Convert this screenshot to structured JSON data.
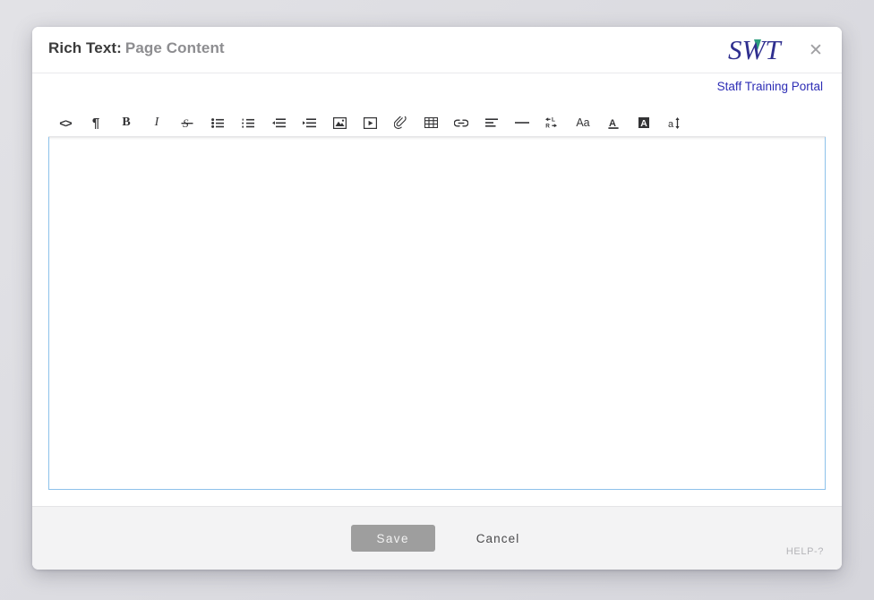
{
  "dialog": {
    "title_prefix": "Rich Text:",
    "title_field": "Page Content",
    "close_label": "✕",
    "brand": {
      "logo_text": "SWT",
      "logo_color": "#2f2f8f",
      "logo_accent_color": "#2e9e7e",
      "portal_link": "Staff Training Portal",
      "portal_link_color": "#2d2db5"
    }
  },
  "toolbar": {
    "items": [
      {
        "name": "source-code-icon",
        "label": "<>",
        "title": "Code View"
      },
      {
        "name": "paragraph-icon",
        "label": "¶",
        "title": "Paragraph Format"
      },
      {
        "name": "bold-icon",
        "label": "B",
        "title": "Bold"
      },
      {
        "name": "italic-icon",
        "label": "I",
        "title": "Italic"
      },
      {
        "name": "strikethrough-icon",
        "label": "S",
        "title": "Strikethrough"
      },
      {
        "name": "unordered-list-icon",
        "label": "",
        "title": "Unordered List"
      },
      {
        "name": "ordered-list-icon",
        "label": "",
        "title": "Ordered List"
      },
      {
        "name": "outdent-icon",
        "label": "",
        "title": "Decrease Indent"
      },
      {
        "name": "indent-icon",
        "label": "",
        "title": "Increase Indent"
      },
      {
        "name": "insert-image-icon",
        "label": "",
        "title": "Insert Image"
      },
      {
        "name": "insert-video-icon",
        "label": "",
        "title": "Insert Video"
      },
      {
        "name": "attach-file-icon",
        "label": "",
        "title": "Attach File"
      },
      {
        "name": "insert-table-icon",
        "label": "",
        "title": "Insert Table"
      },
      {
        "name": "insert-link-icon",
        "label": "",
        "title": "Insert Link"
      },
      {
        "name": "align-left-icon",
        "label": "",
        "title": "Align"
      },
      {
        "name": "horizontal-rule-icon",
        "label": "",
        "title": "Horizontal Line"
      },
      {
        "name": "text-direction-icon",
        "label": "",
        "title": "Text Direction"
      },
      {
        "name": "font-family-icon",
        "label": "Aa",
        "title": "Font Family"
      },
      {
        "name": "text-color-icon",
        "label": "A",
        "title": "Text Color"
      },
      {
        "name": "background-color-icon",
        "label": "A",
        "title": "Background Color"
      },
      {
        "name": "font-size-icon",
        "label": "a",
        "title": "Font Size"
      }
    ]
  },
  "editor": {
    "content": "",
    "placeholder": ""
  },
  "footer": {
    "save_label": "Save",
    "cancel_label": "Cancel",
    "help_label": "HELP-?"
  }
}
